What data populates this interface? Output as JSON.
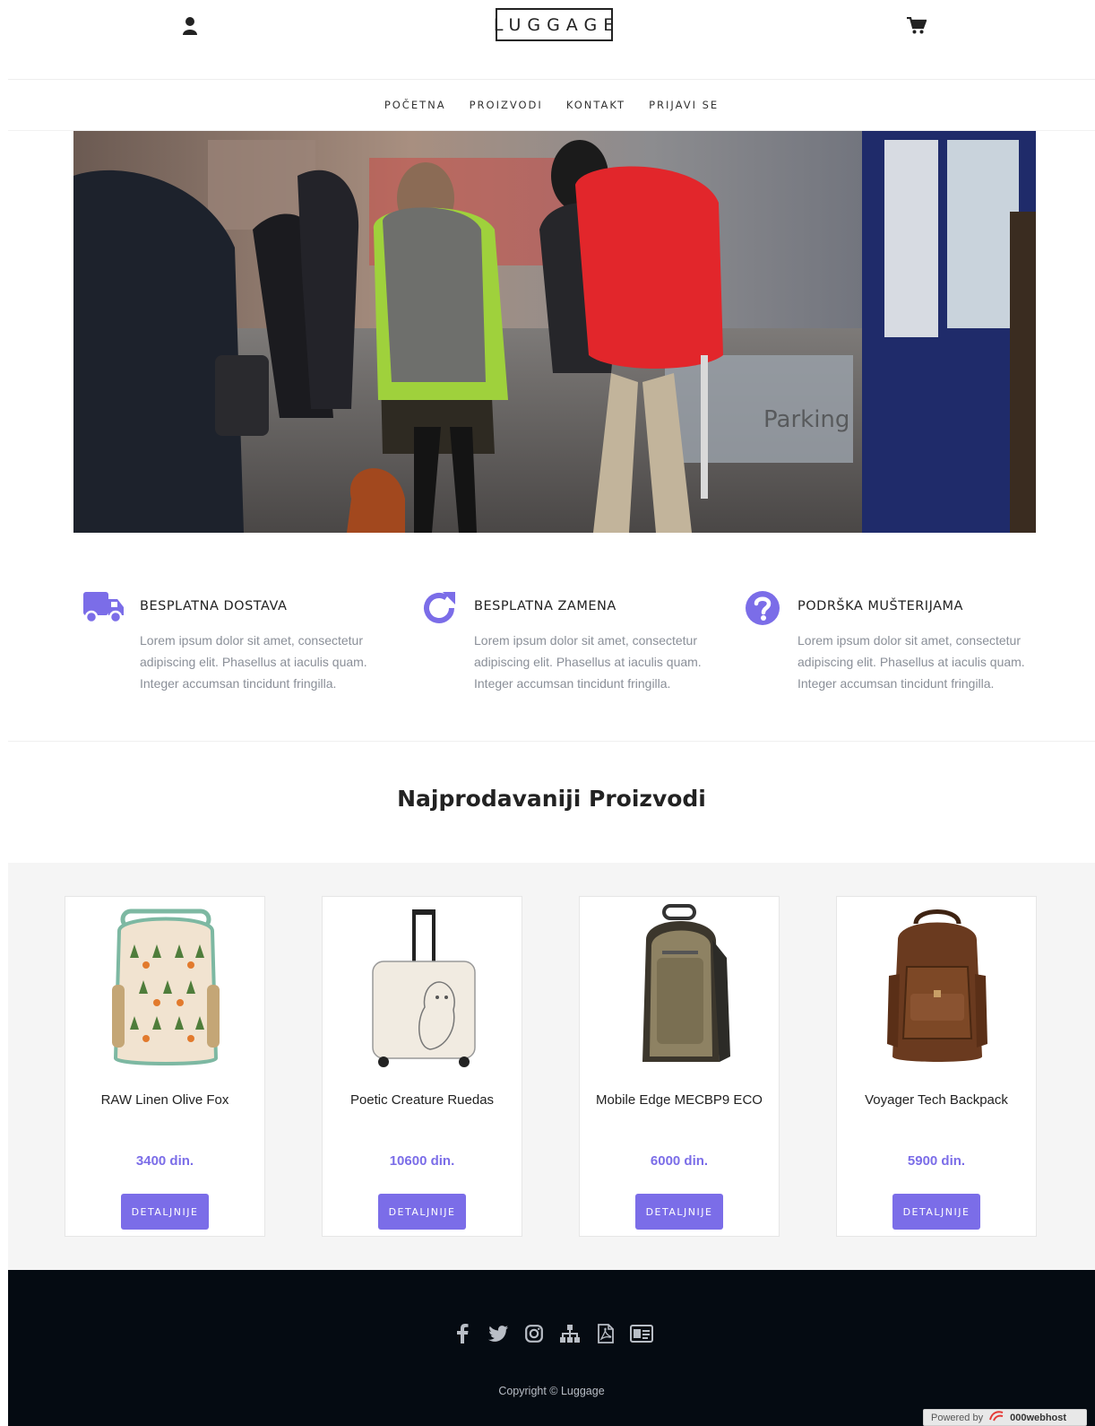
{
  "header": {
    "logo": "LUGGAGE",
    "user_icon": "user-icon",
    "cart_icon": "cart-icon"
  },
  "nav": {
    "items": [
      {
        "label": "POČETNA"
      },
      {
        "label": "PROIZVODI"
      },
      {
        "label": "KONTAKT"
      },
      {
        "label": "PRIJAVI SE"
      }
    ]
  },
  "hero": {
    "image": "photo: two travelers with green and red hiking backpacks at a train station"
  },
  "features": [
    {
      "icon": "truck-icon",
      "title": "BESPLATNA DOSTAVA",
      "text": "Lorem ipsum dolor sit amet, consectetur adipiscing elit. Phasellus at iaculis quam. Integer accumsan tincidunt fringilla."
    },
    {
      "icon": "refresh-icon",
      "title": "BESPLATNA ZAMENA",
      "text": "Lorem ipsum dolor sit amet, consectetur adipiscing elit. Phasellus at iaculis quam. Integer accumsan tincidunt fringilla."
    },
    {
      "icon": "question-circle-icon",
      "title": "PODRŠKA MUŠTERIJAMA",
      "text": "Lorem ipsum dolor sit amet, consectetur adipiscing elit. Phasellus at iaculis quam. Integer accumsan tincidunt fringilla."
    }
  ],
  "section_title": "Najprodavaniji Proizvodi",
  "products": [
    {
      "name": "RAW Linen Olive Fox",
      "price": "3400 din.",
      "button": "DETALJNIJE"
    },
    {
      "name": "Poetic Creature Ruedas",
      "price": "10600 din.",
      "button": "DETALJNIJE"
    },
    {
      "name": "Mobile Edge MECBP9 ECO",
      "price": "6000 din.",
      "button": "DETALJNIJE"
    },
    {
      "name": "Voyager Tech Backpack",
      "price": "5900 din.",
      "button": "DETALJNIJE"
    }
  ],
  "footer": {
    "social_icons": [
      "facebook-icon",
      "twitter-icon",
      "instagram-icon",
      "sitemap-icon",
      "pdf-file-icon",
      "id-card-icon"
    ],
    "copyright": "Copyright © Luggage"
  },
  "powered": {
    "prefix": "Powered by",
    "brand": "000webhost"
  },
  "colors": {
    "accent": "#7b6de8",
    "footer_bg": "#050b12",
    "products_bg": "#f5f5f5"
  }
}
